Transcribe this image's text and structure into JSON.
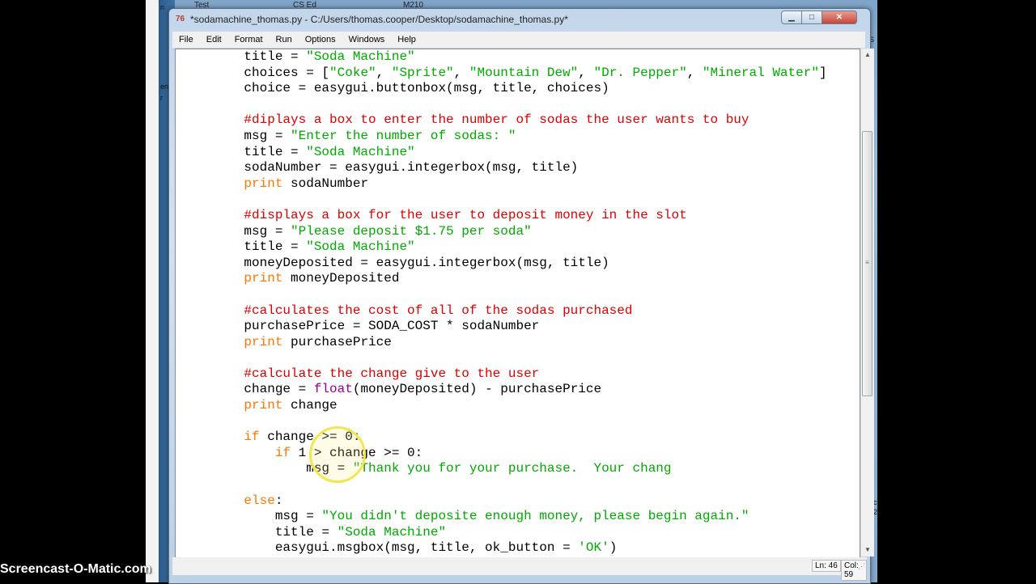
{
  "background": {
    "taskbar_items": [
      "Test",
      "CS Ed",
      "M210"
    ],
    "left_fragments": [
      "n",
      "ent",
      "r"
    ],
    "right_fragments": [
      "S",
      "1c",
      "12"
    ]
  },
  "window": {
    "app_icon": "76",
    "title": "*sodamachine_thomas.py - C:/Users/thomas.cooper/Desktop/sodamachine_thomas.py*",
    "controls": {
      "minimize": "▁",
      "maximize": "□",
      "close": "✕"
    }
  },
  "menu": [
    "File",
    "Edit",
    "Format",
    "Run",
    "Options",
    "Windows",
    "Help"
  ],
  "code_lines": [
    [
      [
        "txt",
        "    title = "
      ],
      [
        "str",
        "\"Soda Machine\""
      ]
    ],
    [
      [
        "txt",
        "    choices = ["
      ],
      [
        "str",
        "\"Coke\""
      ],
      [
        "txt",
        ", "
      ],
      [
        "str",
        "\"Sprite\""
      ],
      [
        "txt",
        ", "
      ],
      [
        "str",
        "\"Mountain Dew\""
      ],
      [
        "txt",
        ", "
      ],
      [
        "str",
        "\"Dr. Pepper\""
      ],
      [
        "txt",
        ", "
      ],
      [
        "str",
        "\"Mineral Water\""
      ],
      [
        "txt",
        "]"
      ]
    ],
    [
      [
        "txt",
        "    choice = easygui.buttonbox(msg, title, choices)"
      ]
    ],
    [
      [
        "txt",
        ""
      ]
    ],
    [
      [
        "cm",
        "    #diplays a box to enter the number of sodas the user wants to buy"
      ]
    ],
    [
      [
        "txt",
        "    msg = "
      ],
      [
        "str",
        "\"Enter the number of sodas: \""
      ]
    ],
    [
      [
        "txt",
        "    title = "
      ],
      [
        "str",
        "\"Soda Machine\""
      ]
    ],
    [
      [
        "txt",
        "    sodaNumber = easygui.integerbox(msg, title)"
      ]
    ],
    [
      [
        "kw",
        "    print"
      ],
      [
        "txt",
        " sodaNumber"
      ]
    ],
    [
      [
        "txt",
        ""
      ]
    ],
    [
      [
        "cm",
        "    #displays a box for the user to deposit money in the slot"
      ]
    ],
    [
      [
        "txt",
        "    msg = "
      ],
      [
        "str",
        "\"Please deposit $1.75 per soda\""
      ]
    ],
    [
      [
        "txt",
        "    title = "
      ],
      [
        "str",
        "\"Soda Machine\""
      ]
    ],
    [
      [
        "txt",
        "    moneyDeposited = easygui.integerbox(msg, title)"
      ]
    ],
    [
      [
        "kw",
        "    print"
      ],
      [
        "txt",
        " moneyDeposited"
      ]
    ],
    [
      [
        "txt",
        ""
      ]
    ],
    [
      [
        "cm",
        "    #calculates the cost of all of the sodas purchased"
      ]
    ],
    [
      [
        "txt",
        "    purchasePrice = SODA_COST * sodaNumber"
      ]
    ],
    [
      [
        "kw",
        "    print"
      ],
      [
        "txt",
        " purchasePrice"
      ]
    ],
    [
      [
        "txt",
        ""
      ]
    ],
    [
      [
        "cm",
        "    #calculate the change give to the user"
      ]
    ],
    [
      [
        "txt",
        "    change = "
      ],
      [
        "bi",
        "float"
      ],
      [
        "txt",
        "(moneyDeposited) - purchasePrice"
      ]
    ],
    [
      [
        "kw",
        "    print"
      ],
      [
        "txt",
        " change"
      ]
    ],
    [
      [
        "txt",
        ""
      ]
    ],
    [
      [
        "kw",
        "    if"
      ],
      [
        "txt",
        " change >= 0:"
      ]
    ],
    [
      [
        "kw",
        "        if"
      ],
      [
        "txt",
        " 1 > change >= 0:"
      ]
    ],
    [
      [
        "txt",
        "            msg = "
      ],
      [
        "str",
        "\"Thank you for your purchase.  Your chang"
      ]
    ],
    [
      [
        "txt",
        ""
      ]
    ],
    [
      [
        "kw",
        "    else"
      ],
      [
        "txt",
        ":"
      ]
    ],
    [
      [
        "txt",
        "        msg = "
      ],
      [
        "str",
        "\"You didn't deposite enough money, please begin again.\""
      ]
    ],
    [
      [
        "txt",
        "        title = "
      ],
      [
        "str",
        "\"Soda Machine\""
      ]
    ],
    [
      [
        "txt",
        "        easygui.msgbox(msg, title, ok_button = "
      ],
      [
        "str",
        "'OK'"
      ],
      [
        "txt",
        ")"
      ]
    ]
  ],
  "status": {
    "line": "Ln: 46",
    "col": "Col: 59"
  },
  "scrollbar": {
    "position_fraction": 0.32,
    "thumb_fraction": 0.55
  },
  "watermark": "Screencast-O-Matic.com",
  "icons": {
    "scroll_up": "▲",
    "scroll_down": "▼",
    "grip": "≡",
    "resize": "⋰"
  }
}
